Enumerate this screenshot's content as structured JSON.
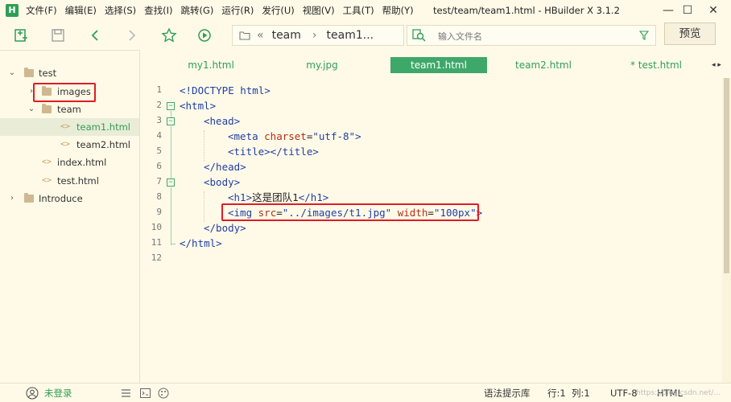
{
  "app": {
    "logo": "H",
    "window_title": "test/team/team1.html - HBuilder X 3.1.2"
  },
  "menu": [
    "文件(F)",
    "编辑(E)",
    "选择(S)",
    "查找(I)",
    "跳转(G)",
    "运行(R)",
    "发行(U)",
    "视图(V)",
    "工具(T)",
    "帮助(Y)"
  ],
  "window_controls": {
    "minimize": "—",
    "maximize": "☐",
    "close": "✕"
  },
  "toolbar": {
    "icons": [
      "new-file-icon",
      "save-icon",
      "back-icon",
      "forward-icon",
      "favorite-icon",
      "run-icon"
    ],
    "path": {
      "separator": "«",
      "segment1": "team",
      "segment2": "team1..."
    },
    "search_placeholder": "输入文件名",
    "preview_label": "预览"
  },
  "sidebar": {
    "items": [
      {
        "label": "test",
        "type": "folder",
        "expanded": true
      },
      {
        "label": "images",
        "type": "folder",
        "expanded": false
      },
      {
        "label": "team",
        "type": "folder",
        "expanded": true
      },
      {
        "label": "team1.html",
        "type": "file",
        "selected": true
      },
      {
        "label": "team2.html",
        "type": "file"
      },
      {
        "label": "index.html",
        "type": "file"
      },
      {
        "label": "test.html",
        "type": "file"
      },
      {
        "label": "Introduce",
        "type": "project",
        "expanded": false
      }
    ]
  },
  "tabs": [
    {
      "label": "my1.html",
      "active": false
    },
    {
      "label": "my.jpg",
      "active": false
    },
    {
      "label": "team1.html",
      "active": true
    },
    {
      "label": "team2.html",
      "active": false
    },
    {
      "label": "* test.html",
      "active": false
    }
  ],
  "tab_scroll": "◂ ▸",
  "editor": {
    "line_numbers": [
      "1",
      "2",
      "3",
      "4",
      "5",
      "6",
      "7",
      "8",
      "9",
      "10",
      "11",
      "12"
    ],
    "lines": {
      "l1": "<!DOCTYPE html>",
      "l2": "<html>",
      "l3": "<head>",
      "l4_open": "<meta ",
      "l4_attr": "charset",
      "l4_eq": "=",
      "l4_val": "\"utf-8\"",
      "l4_close": ">",
      "l5": "<title></title>",
      "l6": "</head>",
      "l7": "<body>",
      "l8_open": "<h1>",
      "l8_text": "这是团队1",
      "l8_close": "</h1>",
      "l9_open": "<img ",
      "l9_attr1": "src",
      "l9_eq1": "=",
      "l9_val1": "\"../images/t1.jpg\"",
      "l9_sp": " ",
      "l9_attr2": "width",
      "l9_eq2": "=",
      "l9_val2": "\"100px\"",
      "l9_close": ">",
      "l10": "</body>",
      "l11": "</html>"
    },
    "fold_markers": [
      "−",
      "−",
      "−"
    ]
  },
  "statusbar": {
    "user": "未登录",
    "hint": "语法提示库",
    "line": "行:1",
    "col": "列:1",
    "encoding": "UTF-8",
    "language": "HTML",
    "watermark": "https://blog.csdn.net/…"
  },
  "colors": {
    "accent": "#2f9e55",
    "active_tab": "#3ea86a",
    "highlight_box": "#e31b23",
    "background": "#fffae8"
  }
}
